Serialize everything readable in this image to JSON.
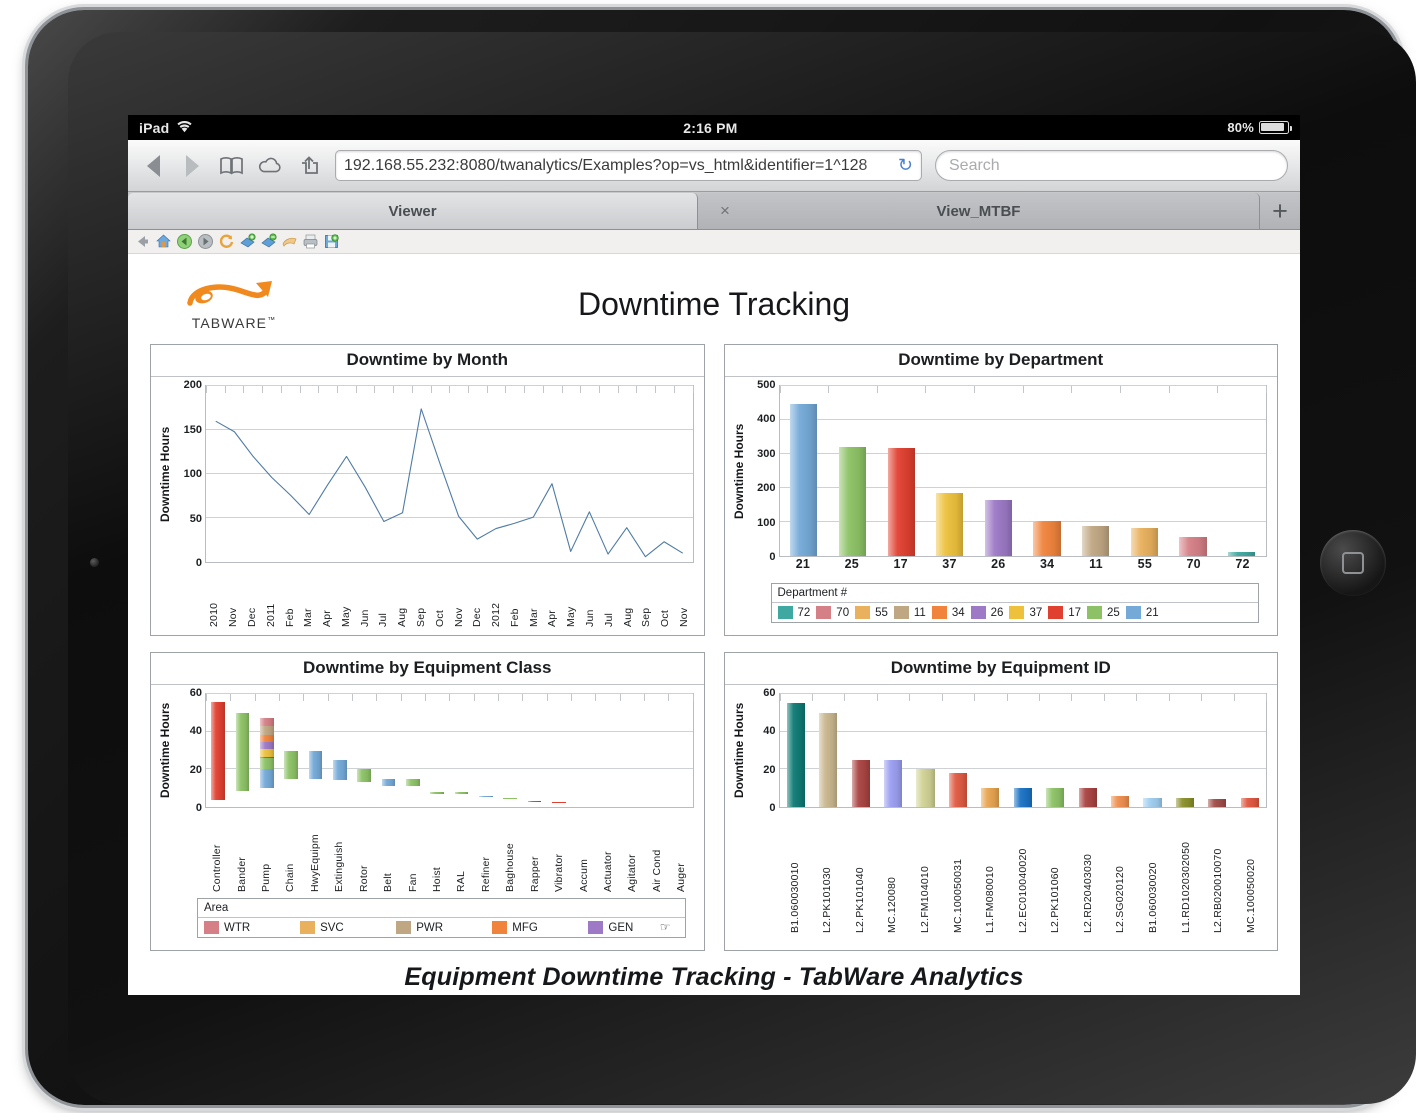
{
  "device": {
    "status_bar": {
      "device_label": "iPad",
      "wifi_icon": "wifi-icon",
      "time": "2:16 PM",
      "battery_percent": "80%",
      "battery_icon": "battery-icon"
    },
    "home_button": "home-button"
  },
  "browser": {
    "back_icon": "back-arrow-icon",
    "forward_icon": "forward-arrow-icon",
    "bookmarks_icon": "bookmarks-book-icon",
    "cloud_icon": "icloud-tabs-icon",
    "share_icon": "share-export-icon",
    "url": "192.168.55.232:8080/twanalytics/Examples?op=vs_html&identifier=1^128",
    "reload_icon": "reload-icon",
    "search_placeholder": "Search",
    "search_value": "",
    "tabs": [
      {
        "label": "Viewer",
        "active": true
      },
      {
        "label": "View_MTBF",
        "active": false
      }
    ],
    "tab_close_icon": "close-icon",
    "new_tab_label": "+"
  },
  "app_toolbar": {
    "icons": [
      "back-arrow-icon",
      "home-icon",
      "previous-page-icon",
      "next-page-icon",
      "refresh-icon",
      "drill-down-icon",
      "drill-up-icon",
      "undo-icon",
      "print-icon",
      "save-icon"
    ]
  },
  "report": {
    "logo_text": "TABWARE",
    "logo_trademark": "™",
    "title": "Downtime Tracking",
    "footer": "Equipment Downtime Tracking - TabWare Analytics",
    "cursor_icon": "hand-cursor-icon"
  },
  "colors": {
    "line_series": "#4f7ba6",
    "dept_21": "#74a9d8",
    "dept_25": "#8cc265",
    "dept_17": "#e04030",
    "dept_37": "#edc13c",
    "dept_26": "#9d79c6",
    "dept_34": "#f0843c",
    "dept_11": "#c0a783",
    "dept_55": "#e9b05d",
    "dept_70": "#d57f86",
    "dept_72": "#3fa8a0",
    "area_wtr": "#d57f86",
    "area_svc": "#e9b05d",
    "area_pwr": "#c0a783",
    "area_mfg": "#f0843c",
    "area_gen": "#9d79c6"
  },
  "chart_data": [
    {
      "type": "line",
      "title": "Downtime by Month",
      "xlabel": "",
      "ylabel": "Downtime Hours",
      "ylim": [
        0,
        200
      ],
      "yticks": [
        0,
        50,
        100,
        150,
        200
      ],
      "grid": true,
      "legend": null,
      "categories": [
        "2010",
        "Nov",
        "Dec",
        "2011",
        "Feb",
        "Mar",
        "Apr",
        "May",
        "Jun",
        "Jul",
        "Aug",
        "Sep",
        "Oct",
        "Nov",
        "Dec",
        "2012",
        "Feb",
        "Mar",
        "Apr",
        "May",
        "Jun",
        "Jul",
        "Aug",
        "Sep",
        "Oct",
        "Nov"
      ],
      "values": [
        160,
        148,
        120,
        96,
        76,
        54,
        88,
        120,
        85,
        46,
        56,
        174,
        112,
        52,
        26,
        38,
        44,
        51,
        89,
        12,
        57,
        9,
        39,
        6,
        23,
        10
      ],
      "series_color": "#4f7ba6"
    },
    {
      "type": "bar",
      "title": "Downtime by Department",
      "xlabel": "",
      "ylabel": "Downtime Hours",
      "ylim": [
        0,
        500
      ],
      "yticks": [
        0,
        100,
        200,
        300,
        400,
        500
      ],
      "grid": true,
      "categories": [
        "21",
        "25",
        "17",
        "37",
        "26",
        "34",
        "11",
        "55",
        "70",
        "72"
      ],
      "values": [
        448,
        322,
        318,
        184,
        166,
        102,
        88,
        81,
        57,
        13
      ],
      "bar_colors": [
        "#74a9d8",
        "#8cc265",
        "#e04030",
        "#edc13c",
        "#9d79c6",
        "#f0843c",
        "#c0a783",
        "#e9b05d",
        "#d57f86",
        "#3fa8a0"
      ],
      "legend": {
        "title": "Department #",
        "position": "bottom",
        "entries": [
          {
            "label": "72",
            "color": "#3fa8a0"
          },
          {
            "label": "70",
            "color": "#d57f86"
          },
          {
            "label": "55",
            "color": "#e9b05d"
          },
          {
            "label": "11",
            "color": "#c0a783"
          },
          {
            "label": "34",
            "color": "#f0843c"
          },
          {
            "label": "26",
            "color": "#9d79c6"
          },
          {
            "label": "37",
            "color": "#edc13c"
          },
          {
            "label": "17",
            "color": "#e04030"
          },
          {
            "label": "25",
            "color": "#8cc265"
          },
          {
            "label": "21",
            "color": "#74a9d8"
          }
        ]
      }
    },
    {
      "type": "bar",
      "title": "Downtime by Equipment Class",
      "xlabel": "",
      "ylabel": "Downtime Hours",
      "ylim": [
        0,
        60
      ],
      "yticks": [
        0,
        20,
        40,
        60
      ],
      "grid": true,
      "stacked": true,
      "categories": [
        "Controller",
        "Bander",
        "Pump",
        "Chain",
        "HwyEquipm",
        "Extinguish",
        "Rotor",
        "Belt",
        "Fan",
        "Hoist",
        "RAL",
        "Refiner",
        "Baghouse",
        "Rapper",
        "Vibrator",
        "Accum",
        "Actuator",
        "Agitator",
        "Air Cond",
        "Auger"
      ],
      "values": [
        56,
        50,
        47,
        30,
        30,
        25,
        20,
        15,
        15,
        8,
        8,
        6,
        5,
        3,
        2.5,
        0,
        0,
        0,
        0,
        0
      ],
      "bar_stacks": [
        [
          {
            "v": 56,
            "c": "#e04030"
          }
        ],
        [
          {
            "v": 50,
            "c": "#8cc265"
          }
        ],
        [
          {
            "v": 13,
            "c": "#74a9d8"
          },
          {
            "v": 7,
            "c": "#8cc265"
          },
          {
            "v": 1,
            "c": "#e04030"
          },
          {
            "v": 5,
            "c": "#edc13c"
          },
          {
            "v": 5,
            "c": "#9d79c6"
          },
          {
            "v": 5,
            "c": "#f0843c"
          },
          {
            "v": 6,
            "c": "#c0a783"
          },
          {
            "v": 5,
            "c": "#d57f86"
          }
        ],
        [
          {
            "v": 30,
            "c": "#8cc265"
          }
        ],
        [
          {
            "v": 30,
            "c": "#74a9d8"
          }
        ],
        [
          {
            "v": 25,
            "c": "#74a9d8"
          }
        ],
        [
          {
            "v": 20,
            "c": "#8cc265"
          }
        ],
        [
          {
            "v": 15,
            "c": "#74a9d8"
          }
        ],
        [
          {
            "v": 15,
            "c": "#8cc265"
          }
        ],
        [
          {
            "v": 8,
            "c": "#8cc265"
          }
        ],
        [
          {
            "v": 8,
            "c": "#8cc265"
          }
        ],
        [
          {
            "v": 6,
            "c": "#74a9d8"
          }
        ],
        [
          {
            "v": 5,
            "c": "#8cc265"
          }
        ],
        [
          {
            "v": 3,
            "c": "#e04030"
          }
        ],
        [
          {
            "v": 2.5,
            "c": "#e04030"
          }
        ],
        [],
        [],
        [],
        [],
        []
      ],
      "legend": {
        "title": "Area",
        "position": "bottom",
        "entries": [
          {
            "label": "WTR",
            "color": "#d57f86"
          },
          {
            "label": "SVC",
            "color": "#e9b05d"
          },
          {
            "label": "PWR",
            "color": "#c0a783"
          },
          {
            "label": "MFG",
            "color": "#f0843c"
          },
          {
            "label": "GEN",
            "color": "#9d79c6"
          }
        ]
      }
    },
    {
      "type": "bar",
      "title": "Downtime by Equipment ID",
      "xlabel": "",
      "ylabel": "Downtime Hours",
      "ylim": [
        0,
        60
      ],
      "yticks": [
        0,
        20,
        40,
        60
      ],
      "grid": true,
      "categories": [
        "B1.060030010",
        "L2.PK101030",
        "L2.PK101040",
        "MC.120080",
        "L2.FM104010",
        "MC.100050031",
        "L1.FM080010",
        "L2.EC010040020",
        "L2.PK101060",
        "L2.RD20403030",
        "L2.SG020120",
        "B1.060030020",
        "L1.RD1020302050",
        "L2.RB020010070",
        "MC.100050020"
      ],
      "values": [
        55,
        50,
        25,
        25,
        20,
        18,
        10,
        10,
        10,
        10,
        6,
        5,
        5,
        4,
        5
      ],
      "bar_colors": [
        "#0f7a74",
        "#c9b68e",
        "#a94442",
        "#9a9ef0",
        "#cfd193",
        "#e05a42",
        "#e7a44f",
        "#1a72c4",
        "#8cc265",
        "#a94442",
        "#ef8f4f",
        "#9ecdf0",
        "#8a8f2a",
        "#a14c48",
        "#e0573f"
      ],
      "legend": null
    }
  ]
}
